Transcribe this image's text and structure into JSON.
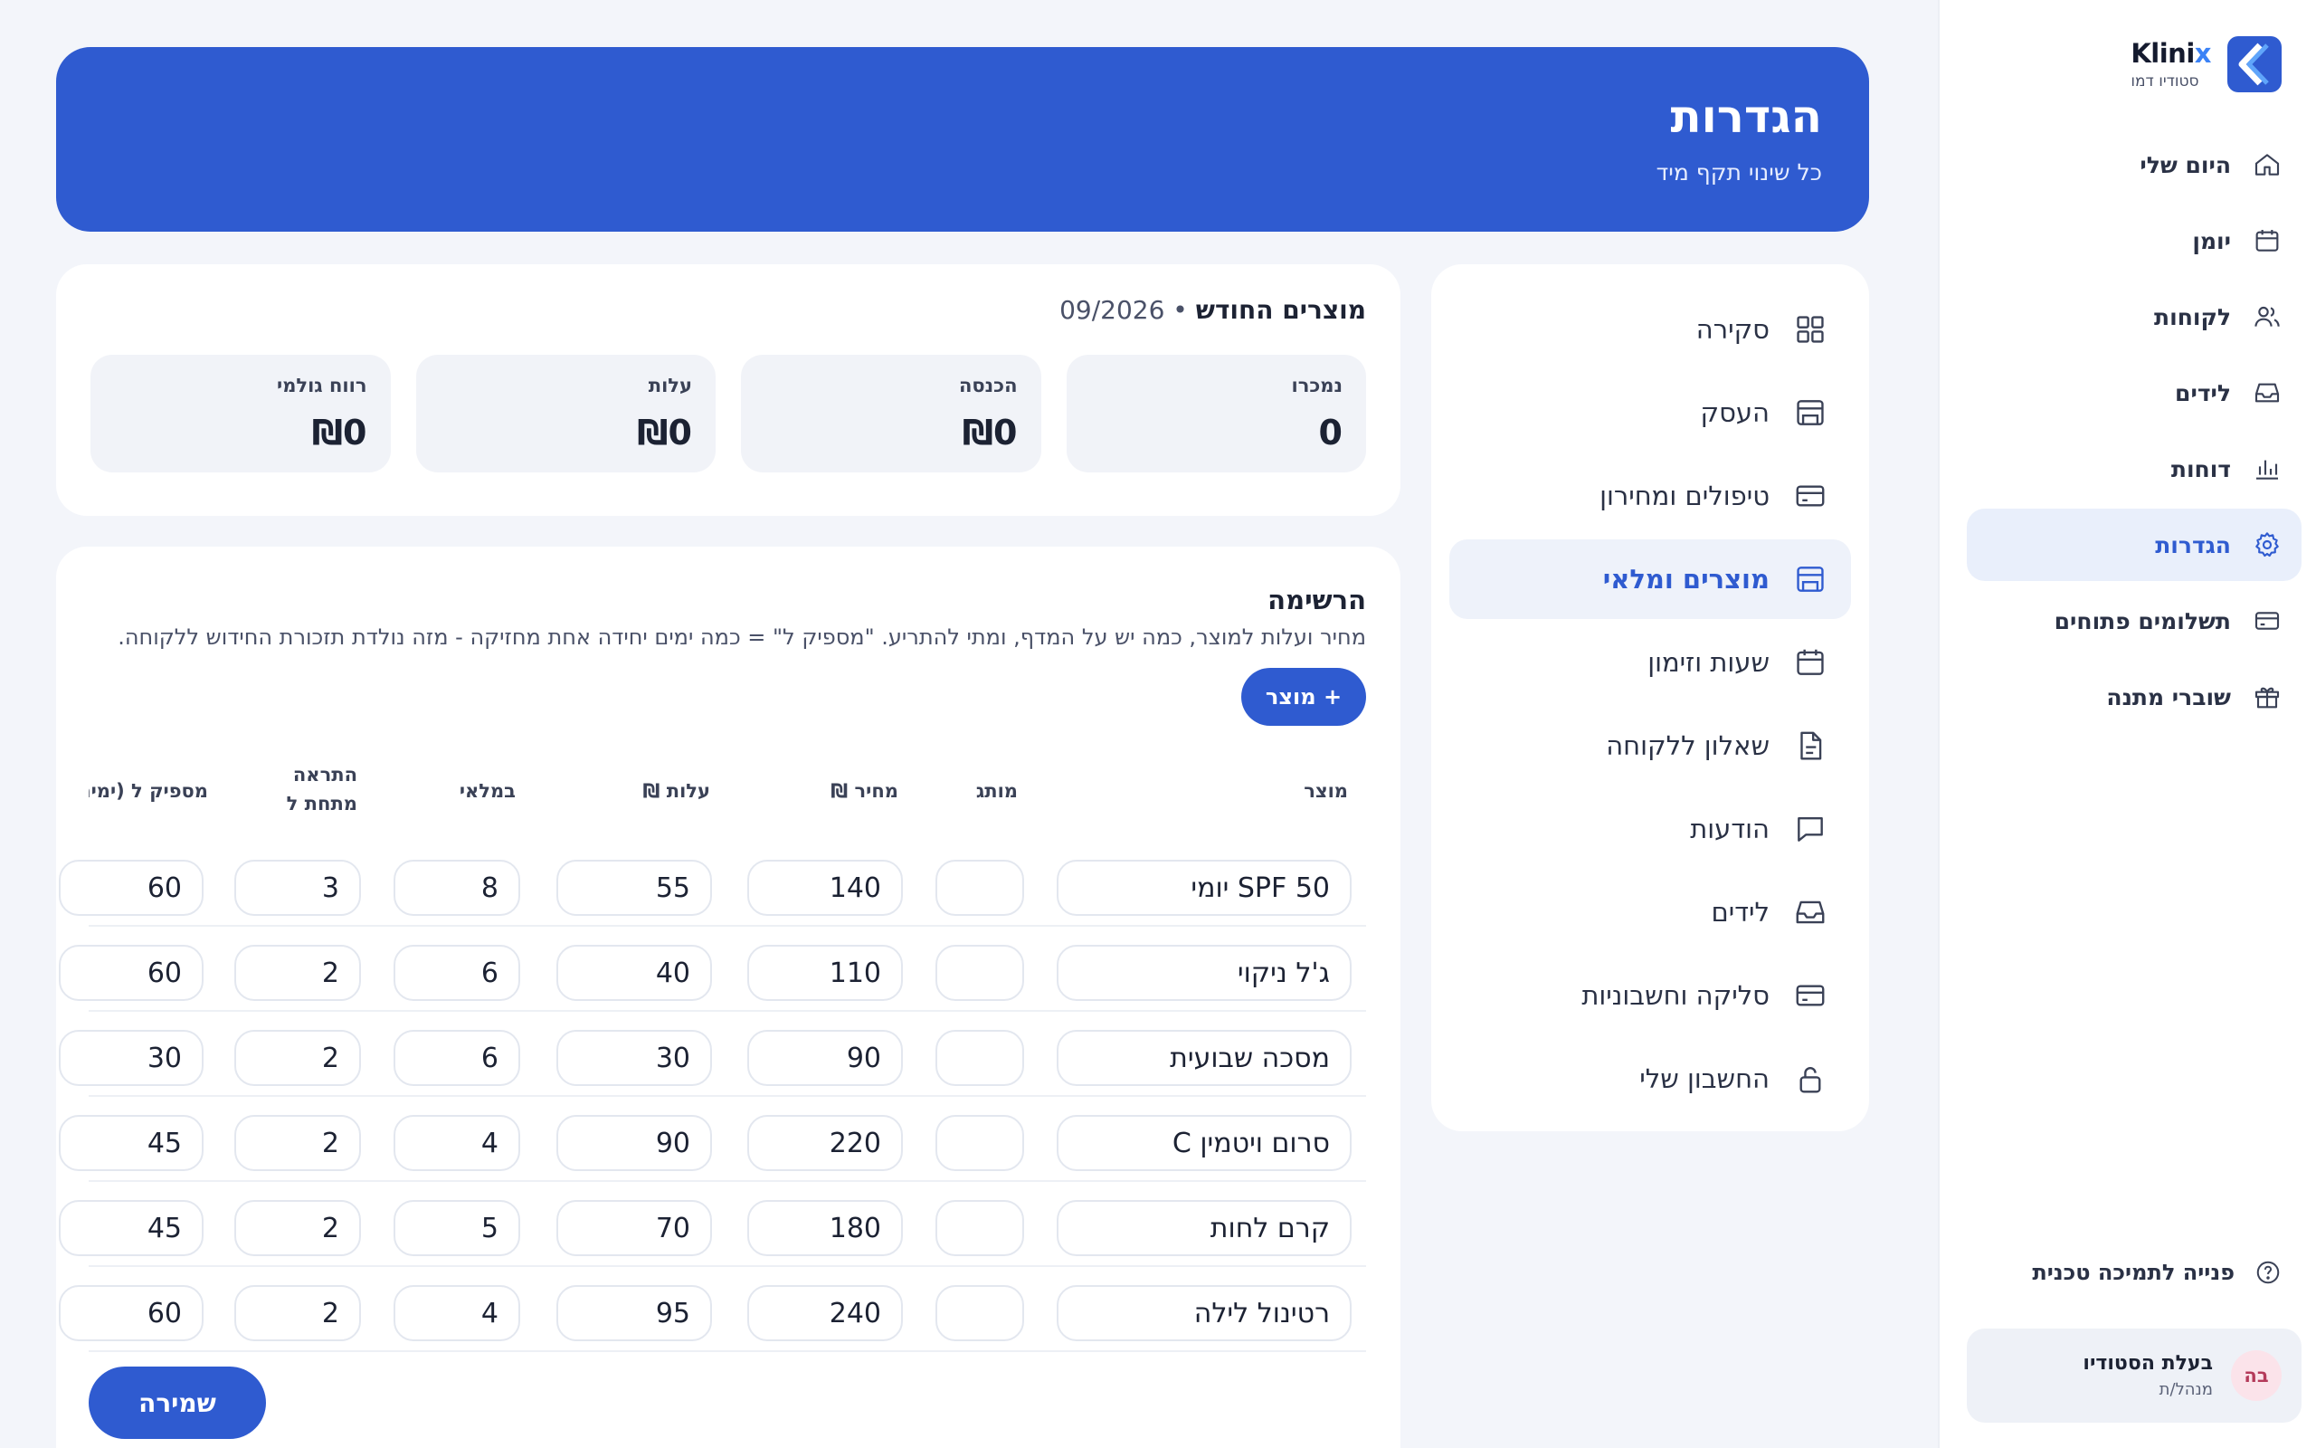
{
  "brand": {
    "name_main": "Klini",
    "name_accent": "x",
    "studio": "סטודיו דמו"
  },
  "colors": {
    "primary": "#2f5bd0",
    "accent": "#3b82f6",
    "active_bg": "#e9effb"
  },
  "sidebar": {
    "items": [
      {
        "label": "היום שלי",
        "icon": "home-icon"
      },
      {
        "label": "יומן",
        "icon": "calendar-icon"
      },
      {
        "label": "לקוחות",
        "icon": "users-icon"
      },
      {
        "label": "לידים",
        "icon": "inbox-icon"
      },
      {
        "label": "דוחות",
        "icon": "bar-chart-icon"
      },
      {
        "label": "הגדרות",
        "icon": "gear-icon",
        "active": true
      },
      {
        "label": "תשלומים פתוחים",
        "icon": "credit-card-icon"
      },
      {
        "label": "שוברי מתנה",
        "icon": "gift-icon"
      }
    ],
    "support": "פנייה לתמיכה טכנית",
    "user": {
      "initials": "בה",
      "name": "בעלת הסטודיו",
      "role": "מנהל/ת"
    }
  },
  "header": {
    "title": "הגדרות",
    "subtitle": "כל שינוי תקף מיד"
  },
  "subnav": {
    "items": [
      {
        "label": "סקירה",
        "icon": "grid-icon"
      },
      {
        "label": "העסק",
        "icon": "store-icon"
      },
      {
        "label": "טיפולים ומחירון",
        "icon": "card-icon"
      },
      {
        "label": "מוצרים ומלאי",
        "icon": "store-icon",
        "active": true
      },
      {
        "label": "שעות וזימון",
        "icon": "calendar-icon"
      },
      {
        "label": "שאלון ללקוחה",
        "icon": "document-icon"
      },
      {
        "label": "הודעות",
        "icon": "message-icon"
      },
      {
        "label": "לידים",
        "icon": "inbox-icon"
      },
      {
        "label": "סליקה וחשבוניות",
        "icon": "card-icon"
      },
      {
        "label": "החשבון שלי",
        "icon": "lock-icon"
      }
    ]
  },
  "stats": {
    "heading": "מוצרים החודש",
    "period": "• 09/2026",
    "items": [
      {
        "label": "נמכרו",
        "value": "0"
      },
      {
        "label": "הכנסה",
        "value": "₪0"
      },
      {
        "label": "עלות",
        "value": "₪0"
      },
      {
        "label": "רווח גולמי",
        "value": "₪0"
      }
    ]
  },
  "list": {
    "title": "הרשימה",
    "description": "מחיר ועלות למוצר, כמה יש על המדף, ומתי להתריע. \"מספיק ל\" = כמה ימים יחידה אחת מחזיקה - מזה נולדת תזכורת החידוש ללקוחה.",
    "add_label": "+ מוצר",
    "save_label": "שמירה",
    "columns": {
      "product": "מוצר",
      "brand": "מותג",
      "price": "מחיר ₪",
      "cost": "עלות ₪",
      "stock": "במלאי",
      "alert_line1": "התראה",
      "alert_line2": "מתחת ל",
      "lasts": "מספיק ל (ימים)"
    },
    "rows": [
      {
        "name": "SPF 50 יומי",
        "brand": "",
        "price": "140",
        "cost": "55",
        "stock": "8",
        "alert": "3",
        "lasts": "60"
      },
      {
        "name": "ג'ל ניקוי",
        "brand": "",
        "price": "110",
        "cost": "40",
        "stock": "6",
        "alert": "2",
        "lasts": "60"
      },
      {
        "name": "מסכה שבועית",
        "brand": "",
        "price": "90",
        "cost": "30",
        "stock": "6",
        "alert": "2",
        "lasts": "30"
      },
      {
        "name": "סרום ויטמין C",
        "brand": "",
        "price": "220",
        "cost": "90",
        "stock": "4",
        "alert": "2",
        "lasts": "45"
      },
      {
        "name": "קרם לחות",
        "brand": "",
        "price": "180",
        "cost": "70",
        "stock": "5",
        "alert": "2",
        "lasts": "45"
      },
      {
        "name": "רטינול לילה",
        "brand": "",
        "price": "240",
        "cost": "95",
        "stock": "4",
        "alert": "2",
        "lasts": "60"
      }
    ]
  }
}
